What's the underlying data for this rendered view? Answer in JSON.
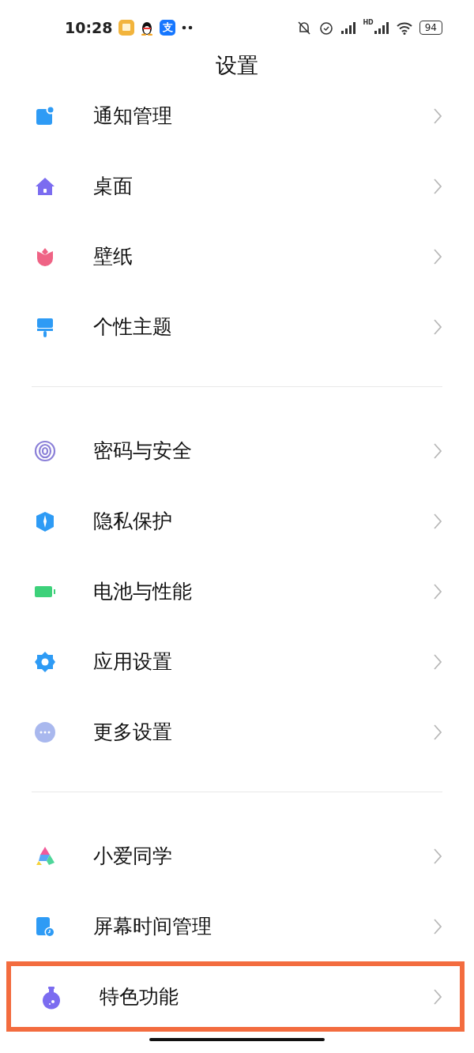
{
  "status_bar": {
    "time": "10:28",
    "app_logo_text": "支",
    "network_label": "HD",
    "battery": "94"
  },
  "title": "设置",
  "groups": [
    {
      "items": [
        {
          "label": "通知管理",
          "highlighted": false
        },
        {
          "label": "桌面",
          "highlighted": false
        },
        {
          "label": "壁纸",
          "highlighted": false
        },
        {
          "label": "个性主题",
          "highlighted": false
        }
      ]
    },
    {
      "items": [
        {
          "label": "密码与安全",
          "highlighted": false
        },
        {
          "label": "隐私保护",
          "highlighted": false
        },
        {
          "label": "电池与性能",
          "highlighted": false
        },
        {
          "label": "应用设置",
          "highlighted": false
        },
        {
          "label": "更多设置",
          "highlighted": false
        }
      ]
    },
    {
      "items": [
        {
          "label": "小爱同学",
          "highlighted": false
        },
        {
          "label": "屏幕时间管理",
          "highlighted": false
        },
        {
          "label": "特色功能",
          "highlighted": true
        }
      ]
    }
  ]
}
